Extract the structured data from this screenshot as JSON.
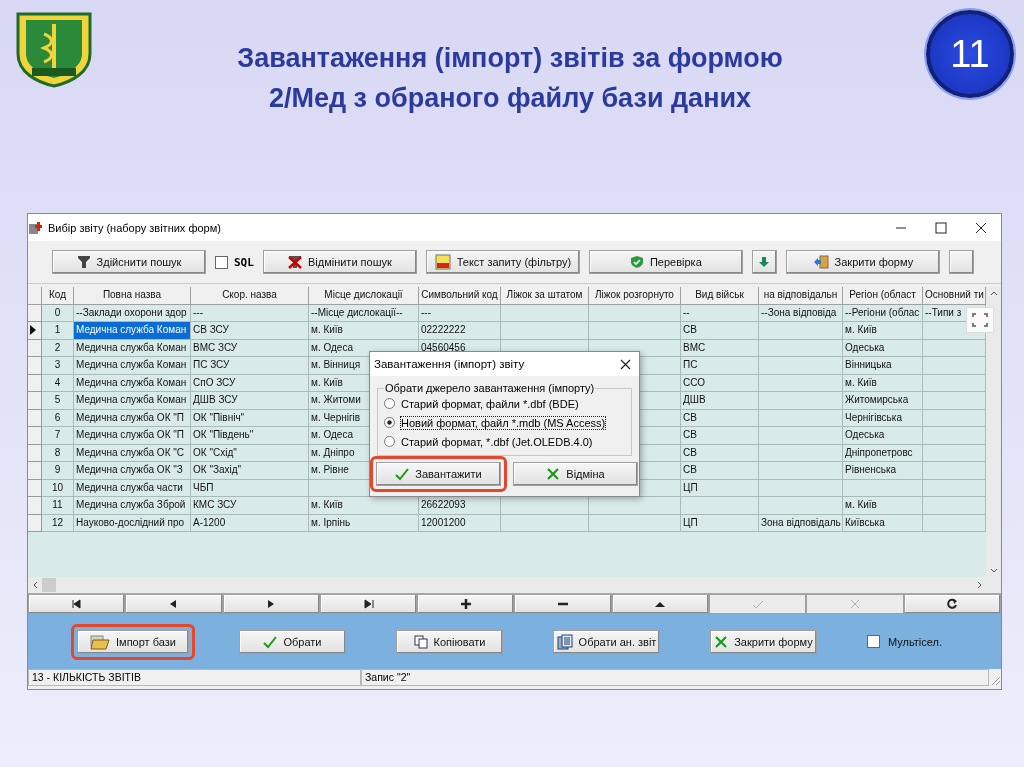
{
  "slide": {
    "title_lines": [
      "Завантаження (імпорт) звітів за формою",
      "2/Мед з обраного файлу бази даних"
    ],
    "page_number": "11"
  },
  "window": {
    "title": "Вибір звіту (набору звітних форм)"
  },
  "toolbar": [
    {
      "kind": "button",
      "label": "Здійснити пошук"
    },
    {
      "kind": "checkbox",
      "label": "SQL",
      "checked": false
    },
    {
      "kind": "button",
      "label": "Відмінити пошук"
    },
    {
      "kind": "button",
      "label": "Текст запиту (фільтру)"
    },
    {
      "kind": "button",
      "label": "Перевірка"
    },
    {
      "kind": "icon_button"
    },
    {
      "kind": "button",
      "label": "Закрити форму"
    },
    {
      "kind": "icon_button"
    }
  ],
  "table": {
    "columns": [
      "Код",
      "Повна назва",
      "Скор. назва",
      "Місце дислокації",
      "Символьний код",
      "Ліжок за штатом",
      "Ліжок розгорнуто",
      "Вид військ",
      "на відповідальн",
      "Регіон (област",
      "Основний ти"
    ],
    "rows": [
      {
        "selected": false,
        "code": "0",
        "full_name": "--Заклади охорони здор",
        "short_name": "---",
        "location": "--Місце дислокації--",
        "symbol_code": "---",
        "troop_type": "--",
        "responsibility": "--Зона відповіда",
        "region": "--Регіони (облас",
        "main_type": "--Типи з"
      },
      {
        "selected": true,
        "code": "1",
        "full_name": "Медична служба Коман",
        "short_name": "СВ ЗСУ",
        "location": "м. Київ",
        "symbol_code": "02222222",
        "troop_type": "СВ",
        "region": "м. Київ"
      },
      {
        "selected": false,
        "code": "2",
        "full_name": "Медична служба Коман",
        "short_name": "ВМС ЗСУ",
        "location": "м. Одеса",
        "symbol_code": "04560456",
        "troop_type": "ВМС",
        "region": "Одеська"
      },
      {
        "selected": false,
        "code": "3",
        "full_name": "Медична служба Коман",
        "short_name": "ПС ЗСУ",
        "location": "м. Вінниця",
        "troop_type": "ПС",
        "region": "Вінницька"
      },
      {
        "selected": false,
        "code": "4",
        "full_name": "Медична служба Коман",
        "short_name": "СпО ЗСУ",
        "location": "м. Київ",
        "troop_type": "ССО",
        "region": "м. Київ"
      },
      {
        "selected": false,
        "code": "5",
        "full_name": "Медична служба Коман",
        "short_name": "ДШВ ЗСУ",
        "location": "м. Житоми",
        "troop_type": "ДШВ",
        "region": "Житомирська"
      },
      {
        "selected": false,
        "code": "6",
        "full_name": "Медична служба ОК \"П",
        "short_name": "ОК \"Північ\"",
        "location": "м. Чернігів",
        "troop_type": "СВ",
        "region": "Чернігівська"
      },
      {
        "selected": false,
        "code": "7",
        "full_name": "Медична служба ОК \"П",
        "short_name": "ОК \"Південь\"",
        "location": "м. Одеса",
        "troop_type": "СВ",
        "region": "Одеська"
      },
      {
        "selected": false,
        "code": "8",
        "full_name": "Медична служба ОК \"С",
        "short_name": "ОК \"Схід\"",
        "location": "м. Дніпро",
        "troop_type": "СВ",
        "region": "Дніпропетровс"
      },
      {
        "selected": false,
        "code": "9",
        "full_name": "Медична служба ОК \"З",
        "short_name": "ОК \"Захід\"",
        "location": "м. Рівне",
        "troop_type": "СВ",
        "region": "Рівненська"
      },
      {
        "selected": false,
        "code": "10",
        "full_name": "Медична служба части",
        "short_name": "ЧБП",
        "troop_type": "ЦП"
      },
      {
        "selected": false,
        "code": "11",
        "full_name": "Медична служба Зброй",
        "short_name": "КМС ЗСУ",
        "location": "м. Київ",
        "symbol_code": "26622093",
        "region": "м. Київ"
      },
      {
        "selected": false,
        "code": "12",
        "full_name": "Науково-дослідний про",
        "short_name": "А-1200",
        "location": "м. Ірпінь",
        "symbol_code": "12001200",
        "troop_type": "ЦП",
        "responsibility": "Зона відповідаль",
        "region": "Київська"
      }
    ]
  },
  "navigator": [
    {
      "disabled": false
    },
    {
      "disabled": false
    },
    {
      "disabled": false
    },
    {
      "disabled": false
    },
    {
      "disabled": false
    },
    {
      "disabled": false
    },
    {
      "disabled": false
    },
    {
      "disabled": true
    },
    {
      "disabled": true
    },
    {
      "disabled": false
    }
  ],
  "actions": [
    {
      "kind": "button",
      "label": "Імпорт бази",
      "highlighted": true
    },
    {
      "kind": "button",
      "label": "Обрати",
      "highlighted": false
    },
    {
      "kind": "button",
      "label": "Копіювати",
      "highlighted": false
    },
    {
      "kind": "button",
      "label": "Обрати ан. звіт",
      "highlighted": false
    },
    {
      "kind": "button",
      "label": "Закрити форму",
      "highlighted": false
    },
    {
      "kind": "checkbox",
      "label": "Мультісел.",
      "checked": false
    }
  ],
  "status_bar": [
    "13 - КІЛЬКІСТЬ ЗВІТІВ",
    "Запис \"2\""
  ],
  "dialog": {
    "title": "Завантаження (імпорт) звіту",
    "group_label": "Обрати джерело завантаження (імпорту)",
    "options": [
      {
        "label": "Старий формат, файли *.dbf (BDE)",
        "selected": false
      },
      {
        "label": "Новий формат, файл *.mdb (MS Access)",
        "selected": true
      },
      {
        "label": "Старий формат, *.dbf (Jet.OLEDB.4.0)",
        "selected": false
      }
    ],
    "buttons": [
      {
        "label": "Завантажити",
        "highlighted": true
      },
      {
        "label": "Відміна",
        "highlighted": false
      }
    ]
  }
}
